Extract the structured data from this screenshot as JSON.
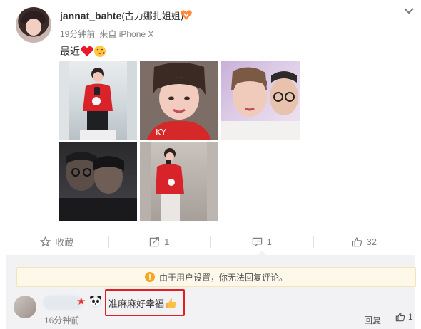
{
  "post": {
    "username": "jannat_bahte",
    "remark": "(古力娜扎姐姐)",
    "time": "19分钟前",
    "source": "来自 iPhone X",
    "text": "最近",
    "content_emojis": [
      "heart-emoji",
      "kiss-emoji"
    ],
    "photo_count": 5
  },
  "toolbar": {
    "favorite_label": "收藏",
    "repost_count": "1",
    "comment_count": "1",
    "like_count": "32"
  },
  "comments": {
    "notice": "由于用户设置，你无法回复评论。",
    "items": [
      {
        "text": "准麻麻好幸福",
        "time": "16分钟前",
        "reply_label": "回复",
        "like_count": "1"
      }
    ]
  },
  "colors": {
    "highlight_border": "#e02020",
    "notice_bg": "#fdf8ea",
    "notice_icon": "#f5a623",
    "muted_text": "#808080"
  }
}
